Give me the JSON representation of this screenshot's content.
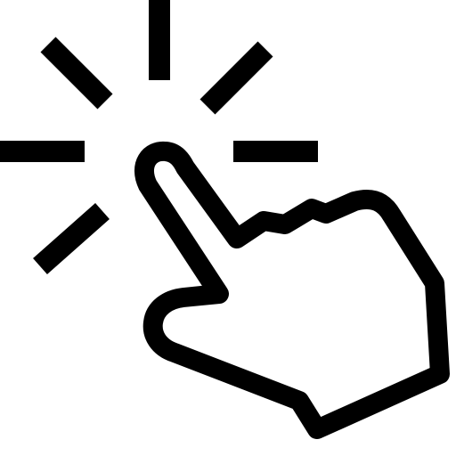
{
  "icon": {
    "name": "tap-hand-icon",
    "stroke_color": "#000000",
    "background_color": "#ffffff"
  }
}
